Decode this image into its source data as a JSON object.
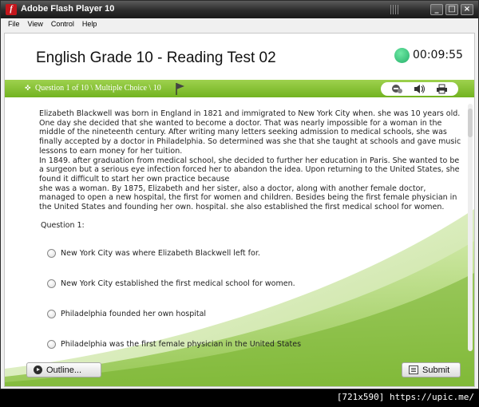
{
  "window": {
    "title": "Adobe Flash Player 10",
    "app_icon": "flash-icon"
  },
  "menubar": {
    "items": [
      "File",
      "View",
      "Control",
      "Help"
    ]
  },
  "header": {
    "title": "English Grade 10 - Reading Test 02",
    "timer": "00:09:55",
    "timer_color": "#2fbd77"
  },
  "question_bar": {
    "label": "Question 1 of 10 \\ Multiple Choice \\ 10",
    "color": "#86c232",
    "tools": [
      "hint-icon",
      "audio-icon",
      "print-icon"
    ]
  },
  "passage": {
    "p1": "Elizabeth Blackwell was born in England in 1821 and immigrated to New York City when. she was 10 years old. One day she decided that she wanted to become a doctor. That was nearly impossible for a woman in the middle of the nineteenth century. After writing many letters seeking admission to medical schools, she was finally accepted by a doctor in Philadelphia. So determined was she that she taught at schools and gave music lessons to earn money for her tuition.",
    "p2": "In 1849. after graduation from medical school, she decided to further her education in Paris. She wanted to be a surgeon but a serious eye infection forced her to abandon the idea. Upon returning to the United States, she found it difficult to start her own practice because",
    "p3": "she was a woman. By 1875, Elizabeth and her sister, also a doctor, along with another female doctor, managed to open a new hospital, the first for women and children. Besides being the first female physician in the United States and founding her own. hospital. she also established the first medical school for women."
  },
  "question": {
    "label": "Question 1:",
    "options": [
      "New York City was where Elizabeth Blackwell left for.",
      "New York City established the first medical school for women.",
      "Philadelphia founded her own hospital",
      "Philadelphia was the first female physician in the United States"
    ]
  },
  "footer": {
    "outline_label": "Outline...",
    "submit_label": "Submit"
  },
  "watermark": "[721x590] https://upic.me/"
}
